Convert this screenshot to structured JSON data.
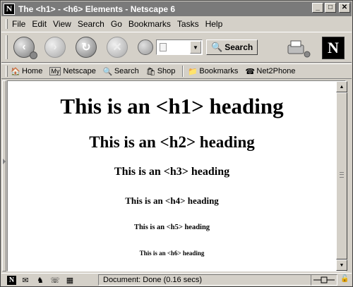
{
  "window": {
    "title": "The <h1> - <h6> Elements - Netscape 6",
    "app_icon": "N",
    "controls": {
      "minimize": "_",
      "maximize": "□",
      "close": "✕"
    }
  },
  "menubar": {
    "items": [
      "File",
      "Edit",
      "View",
      "Search",
      "Go",
      "Bookmarks",
      "Tasks",
      "Help"
    ]
  },
  "navbar": {
    "back_icon": "back-arrow-icon",
    "forward_icon": "forward-arrow-icon",
    "reload_icon": "reload-icon",
    "stop_icon": "stop-icon",
    "search_button": "Search",
    "logo": "N"
  },
  "personal_toolbar": {
    "items": [
      {
        "icon": "🏠",
        "label": "Home"
      },
      {
        "icon": "My",
        "label": "Netscape"
      },
      {
        "icon": "🔍",
        "label": "Search"
      },
      {
        "icon": "🛍",
        "label": "Shop"
      },
      {
        "icon": "📁",
        "label": "Bookmarks"
      },
      {
        "icon": "☎",
        "label": "Net2Phone"
      }
    ]
  },
  "content": {
    "h1": "This is an <h1> heading",
    "h2": "This is an <h2> heading",
    "h3": "This is an <h3> heading",
    "h4": "This is an <h4> heading",
    "h5": "This is an <h5> heading",
    "h6": "This is an <h6> heading"
  },
  "statusbar": {
    "icons": [
      "N",
      "✉",
      "♞",
      "☏",
      "▦"
    ],
    "text": "Document: Done (0.16 secs)"
  },
  "colors": {
    "chrome": "#d4d0c8",
    "titlebar": "#7a7a7a",
    "content_bg": "#ffffff"
  }
}
